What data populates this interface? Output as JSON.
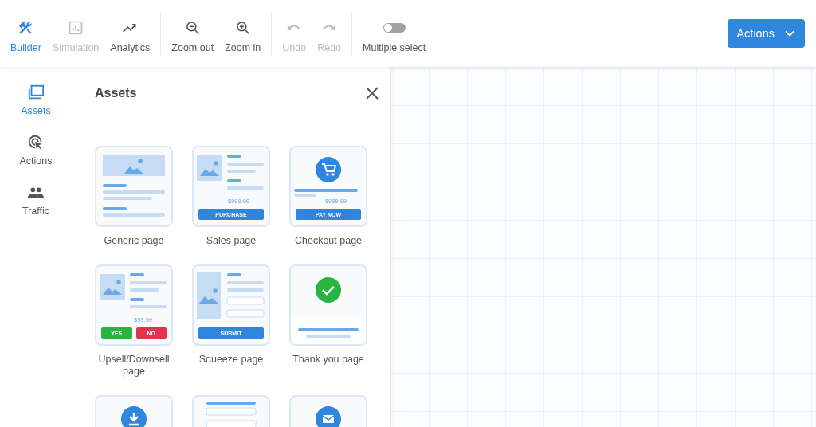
{
  "toolbar": {
    "groups": [
      {
        "items": [
          {
            "label": "Builder",
            "selected": true,
            "disabled": false
          },
          {
            "label": "Simulation",
            "selected": false,
            "disabled": true
          },
          {
            "label": "Analytics",
            "selected": false,
            "disabled": false
          }
        ]
      },
      {
        "items": [
          {
            "label": "Zoom out",
            "selected": false,
            "disabled": false
          },
          {
            "label": "Zoom in",
            "selected": false,
            "disabled": false
          }
        ]
      },
      {
        "items": [
          {
            "label": "Undo",
            "selected": false,
            "disabled": true
          },
          {
            "label": "Redo",
            "selected": false,
            "disabled": true
          }
        ]
      }
    ],
    "toggle": {
      "label": "Multiple select",
      "on": false
    },
    "actions_button": {
      "label": "Actions"
    }
  },
  "sidebar": {
    "items": [
      {
        "label": "Assets",
        "selected": true
      },
      {
        "label": "Actions",
        "selected": false
      },
      {
        "label": "Traffic",
        "selected": false
      }
    ]
  },
  "panel": {
    "title": "Assets",
    "cards": [
      {
        "kind": "generic",
        "label": "Generic page"
      },
      {
        "kind": "sales",
        "label": "Sales page",
        "price": "$999.99",
        "buttons": [
          {
            "label": "PURCHASE",
            "color": "#2e86de"
          }
        ]
      },
      {
        "kind": "checkout",
        "label": "Checkout page",
        "price": "$999.99",
        "buttons": [
          {
            "label": "PAY NOW",
            "color": "#2e86de"
          }
        ]
      },
      {
        "kind": "upsell",
        "label": "Upsell/Downsell page",
        "price": "$99.99",
        "buttons": [
          {
            "label": "YES",
            "color": "#27b53f"
          },
          {
            "label": "NO",
            "color": "#e0344f"
          }
        ]
      },
      {
        "kind": "squeeze",
        "label": "Squeeze page",
        "buttons": [
          {
            "label": "SUBMIT",
            "color": "#2e86de"
          }
        ]
      },
      {
        "kind": "thankyou",
        "label": "Thank you page"
      },
      {
        "kind": "download"
      },
      {
        "kind": "form"
      },
      {
        "kind": "email"
      }
    ]
  }
}
